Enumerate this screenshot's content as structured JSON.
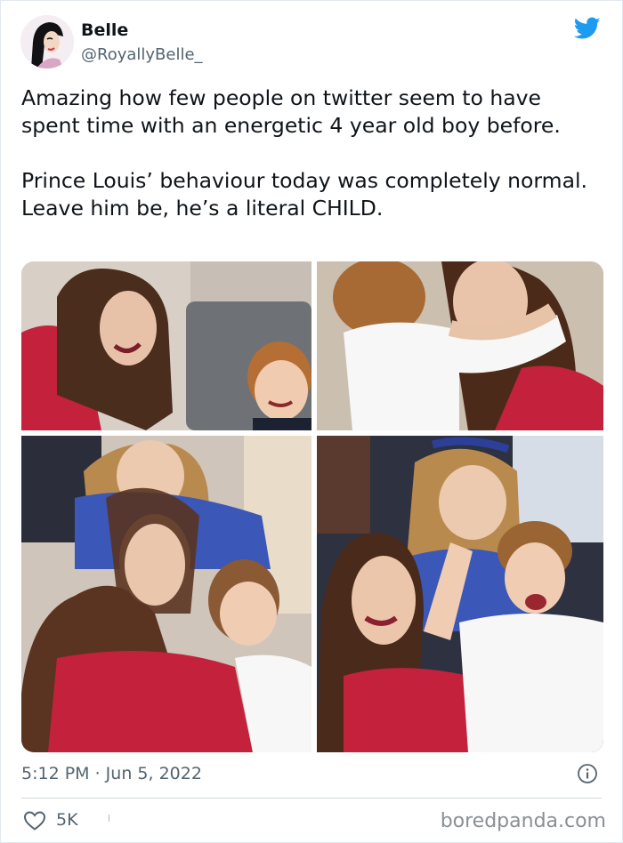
{
  "tweet": {
    "author": {
      "display_name": "Belle",
      "handle": "@RoyallyBelle_"
    },
    "text": "Amazing how few people on twitter seem to have spent time with an energetic 4 year old boy before.\n\nPrince Louis’ behaviour today was completely normal. Leave him be, he’s a literal CHILD.",
    "timestamp": "5:12 PM · Jun 5, 2022",
    "likes": "5K"
  },
  "watermark": "boredpanda.com",
  "colors": {
    "twitter_blue": "#1d9bf0",
    "secondary_text": "#536471",
    "divider": "#cfd9de"
  },
  "icons": {
    "logo": "twitter-bird-icon",
    "info": "info-icon",
    "like": "heart-icon"
  }
}
